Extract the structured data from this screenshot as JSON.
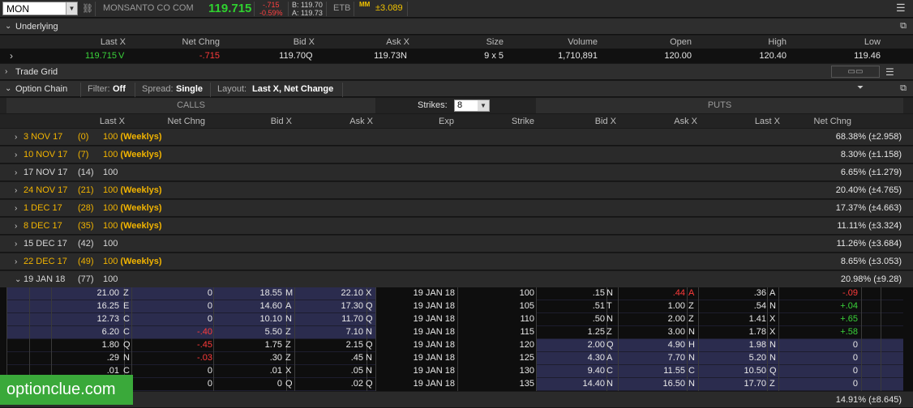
{
  "top": {
    "symbol": "MON",
    "company": "MONSANTO CO COM",
    "last": "119.715",
    "change": "-.715",
    "change_pct": "-0.59%",
    "bid": "B: 119.70",
    "ask": "A: 119.73",
    "etb": "ETB",
    "mm_badge": "MM",
    "mm_value": "±3.089"
  },
  "underlying": {
    "title": "Underlying",
    "headers": [
      "Last X",
      "Net Chng",
      "Bid X",
      "Ask X",
      "Size",
      "Volume",
      "Open",
      "High",
      "Low"
    ],
    "last": "119.715",
    "last_ex": "V",
    "net_chng": "-.715",
    "bid": "119.70",
    "bid_ex": "Q",
    "ask": "119.73",
    "ask_ex": "N",
    "size": "9 x 5",
    "volume": "1,710,891",
    "open": "120.00",
    "high": "120.40",
    "low": "119.46"
  },
  "trade_grid": {
    "title": "Trade Grid"
  },
  "option_chain": {
    "title": "Option Chain",
    "filter_label": "Filter:",
    "filter_value": "Off",
    "spread_label": "Spread:",
    "spread_value": "Single",
    "layout_label": "Layout:",
    "layout_value": "Last X, Net Change",
    "calls": "CALLS",
    "puts": "PUTS",
    "strikes_label": "Strikes:",
    "strikes_value": "8",
    "headers": [
      "Last X",
      "Net Chng",
      "Bid X",
      "Ask X",
      "Exp",
      "Strike",
      "Bid X",
      "Ask X",
      "Last X",
      "Net Chng"
    ]
  },
  "expirations": [
    {
      "date": "3 NOV 17",
      "days": "(0)",
      "mult": "100",
      "tag": "(Weeklys)",
      "weekly": true,
      "iv": "68.38% (±2.958)"
    },
    {
      "date": "10 NOV 17",
      "days": "(7)",
      "mult": "100",
      "tag": "(Weeklys)",
      "weekly": true,
      "iv": "8.30% (±1.158)"
    },
    {
      "date": "17 NOV 17",
      "days": "(14)",
      "mult": "100",
      "tag": "",
      "weekly": false,
      "iv": "6.65% (±1.279)"
    },
    {
      "date": "24 NOV 17",
      "days": "(21)",
      "mult": "100",
      "tag": "(Weeklys)",
      "weekly": true,
      "iv": "20.40% (±4.765)"
    },
    {
      "date": "1 DEC 17",
      "days": "(28)",
      "mult": "100",
      "tag": "(Weeklys)",
      "weekly": true,
      "iv": "17.37% (±4.663)"
    },
    {
      "date": "8 DEC 17",
      "days": "(35)",
      "mult": "100",
      "tag": "(Weeklys)",
      "weekly": true,
      "iv": "11.11% (±3.324)"
    },
    {
      "date": "15 DEC 17",
      "days": "(42)",
      "mult": "100",
      "tag": "",
      "weekly": false,
      "iv": "11.26% (±3.684)"
    },
    {
      "date": "22 DEC 17",
      "days": "(49)",
      "mult": "100",
      "tag": "(Weeklys)",
      "weekly": true,
      "iv": "8.65% (±3.053)"
    },
    {
      "date": "19 JAN 18",
      "days": "(77)",
      "mult": "100",
      "tag": "",
      "weekly": false,
      "iv": "20.98% (±9.28)"
    }
  ],
  "options": [
    {
      "c_last": "21.00",
      "c_last_ex": "Z",
      "c_chg": "0",
      "c_bid": "18.55",
      "c_bid_ex": "M",
      "c_ask": "22.10",
      "c_ask_ex": "X",
      "exp": "19 JAN 18",
      "strike": "100",
      "p_bid": ".15",
      "p_bid_ex": "N",
      "p_ask": ".44",
      "p_ask_ex": "A",
      "p_last": ".36",
      "p_last_ex": "A",
      "p_chg": "-.09",
      "itm_call": true,
      "itm_put": false
    },
    {
      "c_last": "16.25",
      "c_last_ex": "E",
      "c_chg": "0",
      "c_bid": "14.60",
      "c_bid_ex": "A",
      "c_ask": "17.30",
      "c_ask_ex": "Q",
      "exp": "19 JAN 18",
      "strike": "105",
      "p_bid": ".51",
      "p_bid_ex": "T",
      "p_ask": "1.00",
      "p_ask_ex": "Z",
      "p_last": ".54",
      "p_last_ex": "N",
      "p_chg": "+.04",
      "itm_call": true,
      "itm_put": false
    },
    {
      "c_last": "12.73",
      "c_last_ex": "C",
      "c_chg": "0",
      "c_bid": "10.10",
      "c_bid_ex": "N",
      "c_ask": "11.70",
      "c_ask_ex": "Q",
      "exp": "19 JAN 18",
      "strike": "110",
      "p_bid": ".50",
      "p_bid_ex": "N",
      "p_ask": "2.00",
      "p_ask_ex": "Z",
      "p_last": "1.41",
      "p_last_ex": "X",
      "p_chg": "+.65",
      "itm_call": true,
      "itm_put": false
    },
    {
      "c_last": "6.20",
      "c_last_ex": "C",
      "c_chg": "-.40",
      "c_bid": "5.50",
      "c_bid_ex": "Z",
      "c_ask": "7.10",
      "c_ask_ex": "N",
      "exp": "19 JAN 18",
      "strike": "115",
      "p_bid": "1.25",
      "p_bid_ex": "Z",
      "p_ask": "3.00",
      "p_ask_ex": "N",
      "p_last": "1.78",
      "p_last_ex": "X",
      "p_chg": "+.58",
      "itm_call": true,
      "itm_put": false
    },
    {
      "c_last": "1.80",
      "c_last_ex": "Q",
      "c_chg": "-.45",
      "c_bid": "1.75",
      "c_bid_ex": "Z",
      "c_ask": "2.15",
      "c_ask_ex": "Q",
      "exp": "19 JAN 18",
      "strike": "120",
      "p_bid": "2.00",
      "p_bid_ex": "Q",
      "p_ask": "4.90",
      "p_ask_ex": "H",
      "p_last": "1.98",
      "p_last_ex": "N",
      "p_chg": "0",
      "itm_call": false,
      "itm_put": true
    },
    {
      "c_last": ".29",
      "c_last_ex": "N",
      "c_chg": "-.03",
      "c_bid": ".30",
      "c_bid_ex": "Z",
      "c_ask": ".45",
      "c_ask_ex": "N",
      "exp": "19 JAN 18",
      "strike": "125",
      "p_bid": "4.30",
      "p_bid_ex": "A",
      "p_ask": "7.70",
      "p_ask_ex": "N",
      "p_last": "5.20",
      "p_last_ex": "N",
      "p_chg": "0",
      "itm_call": false,
      "itm_put": true
    },
    {
      "c_last": ".01",
      "c_last_ex": "C",
      "c_chg": "0",
      "c_bid": ".01",
      "c_bid_ex": "X",
      "c_ask": ".05",
      "c_ask_ex": "N",
      "exp": "19 JAN 18",
      "strike": "130",
      "p_bid": "9.40",
      "p_bid_ex": "C",
      "p_ask": "11.55",
      "p_ask_ex": "C",
      "p_last": "10.50",
      "p_last_ex": "Q",
      "p_chg": "0",
      "itm_call": false,
      "itm_put": true
    },
    {
      "c_last": "",
      "c_last_ex": "",
      "c_chg": "0",
      "c_bid": "0",
      "c_bid_ex": "Q",
      "c_ask": ".02",
      "c_ask_ex": "Q",
      "exp": "19 JAN 18",
      "strike": "135",
      "p_bid": "14.40",
      "p_bid_ex": "N",
      "p_ask": "16.50",
      "p_ask_ex": "N",
      "p_last": "17.70",
      "p_last_ex": "Z",
      "p_chg": "0",
      "itm_call": false,
      "itm_put": true
    }
  ],
  "next_exp_iv": "14.91% (±8.645)",
  "watermark": "optionclue.com",
  "colors": {
    "positive": "#3ad33a",
    "negative": "#ff3b3b",
    "weekly": "#f2b400",
    "itm": "#2b2c4e"
  }
}
